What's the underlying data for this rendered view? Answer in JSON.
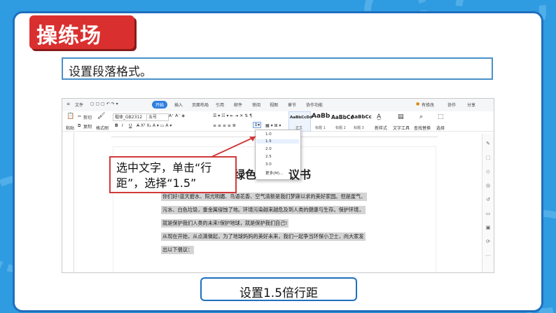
{
  "slide": {
    "section_title": "操练场",
    "instruction": "设置段落格式。",
    "callout": "选中文字，单击“行距”，选择“1.5”",
    "caption": "设置1.5倍行距"
  },
  "app": {
    "menu": [
      "文件",
      "开始",
      "插入",
      "页面布局",
      "引用",
      "邮件",
      "审阅",
      "视图",
      "章节",
      "协作功能"
    ],
    "active_menu": "开始",
    "top_right": [
      "有修改",
      "协作",
      "分享"
    ],
    "toolbar": {
      "paste": "粘贴",
      "format_painter": "格式刷",
      "cut": "剪切",
      "copy": "复制",
      "font_name": "楷体_GB2312",
      "font_size": "五号",
      "styles": [
        {
          "sample": "AaBbCcDd",
          "label": "正文"
        },
        {
          "sample": "AaBb",
          "label": "标题 1"
        },
        {
          "sample": "AaBbCc",
          "label": "标题 2"
        },
        {
          "sample": "AaBbCc",
          "label": "标题 3"
        }
      ],
      "new_style": "新样式",
      "text_tools": "文字工具",
      "find_replace": "查找替换",
      "select": "选择"
    },
    "line_spacing_menu": {
      "options": [
        "1.0",
        "1.5",
        "2.0",
        "2.5",
        "3.0",
        "更多(M)..."
      ],
      "selected": "1.5"
    },
    "document": {
      "title_fragment": "绿色",
      "title_tail": "议书",
      "lines": [
        "你们好!蓝天碧水、阳光明媚、鸟语花香、空气清新是我们梦寐以求的美好家园。但是废气、",
        "污水、白色垃圾，重金属侵蚀了地。环境污染越来越危及到人类的健康与生存。保护环境，",
        "就是保护我们人类的未来!保护地球，就是保护我们自己!",
        "从现在开始，从点滴做起，为了地球妈妈的美好未来，我们一起争当环保小卫士，向大家发",
        "出以下倡议："
      ]
    }
  },
  "colors": {
    "slide_bg": "#2f9be0",
    "title_red": "#d9302f",
    "active_tab": "#2f7fe0",
    "callout_border": "#d23a3a",
    "caption_border": "#1e6fbf"
  }
}
